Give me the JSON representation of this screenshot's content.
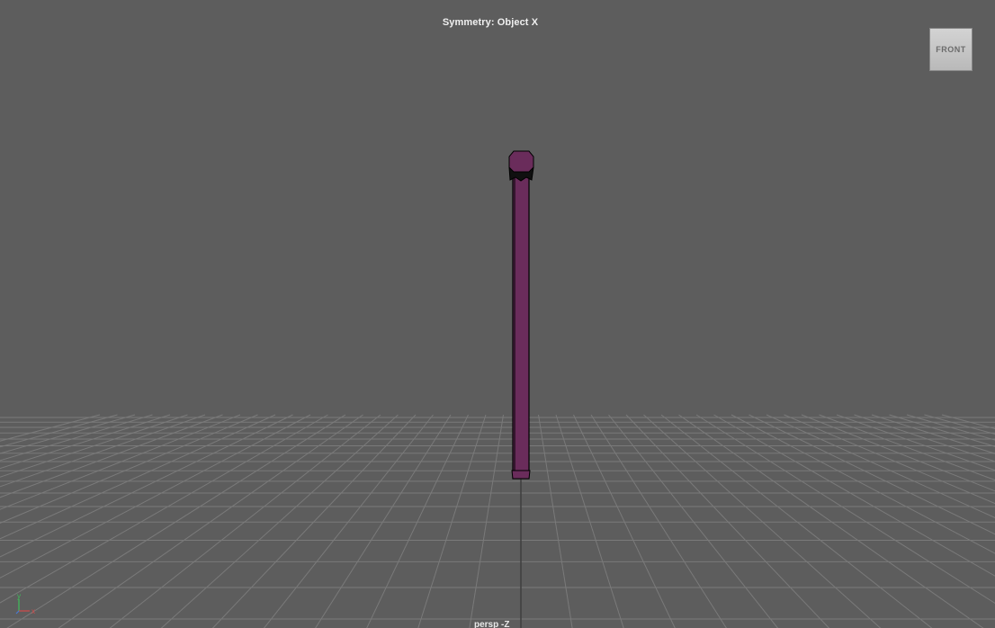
{
  "viewport": {
    "hud_title": "Symmetry: Object X",
    "camera_label": "persp -Z",
    "viewcube_face": "FRONT"
  },
  "axis_gizmo": {
    "y_label": "y",
    "x_label": "x"
  },
  "colors": {
    "background": "#5d5d5d",
    "grid": "#7a7a7a",
    "object_fill": "#6a2c5b",
    "object_outline": "#000000"
  }
}
